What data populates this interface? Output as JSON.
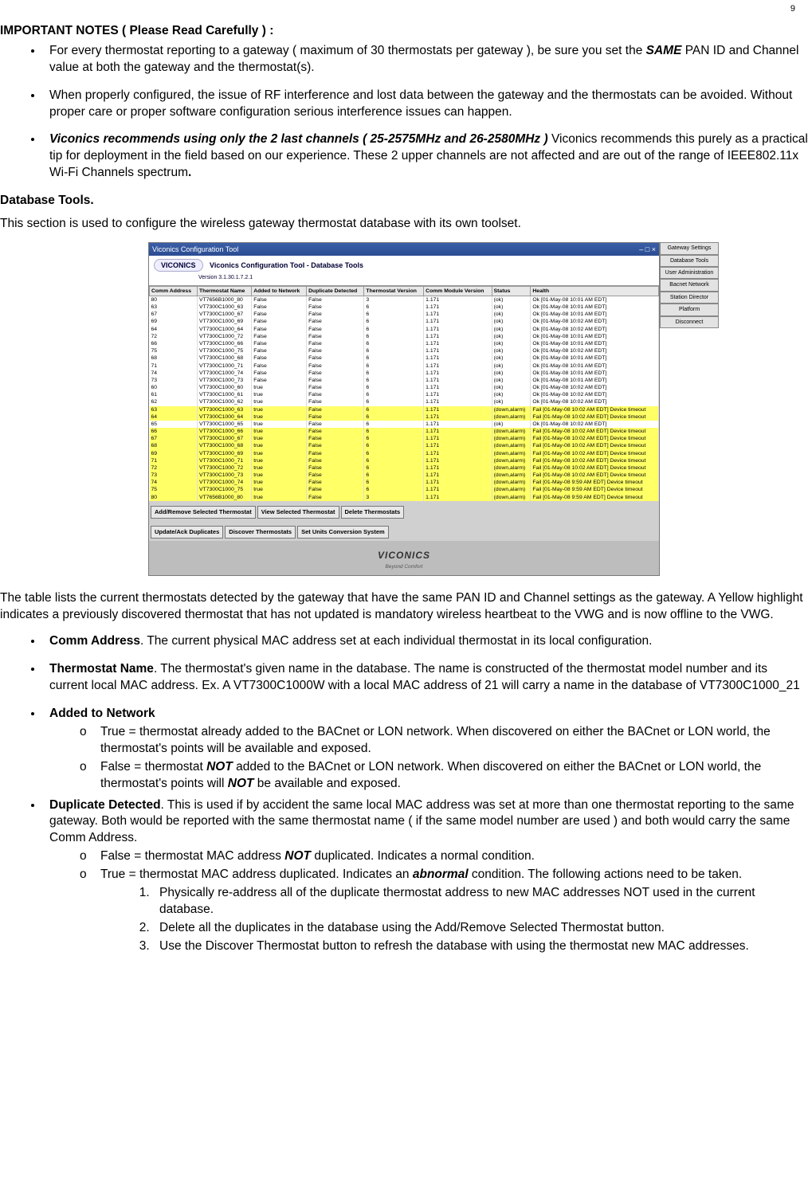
{
  "page_number": "9",
  "important_heading": "IMPORTANT NOTES ( Please Read Carefully ) :",
  "important": [
    {
      "pre": "For every thermostat reporting to a gateway ( maximum of 30 thermostats per gateway ), be sure you set the ",
      "bi": "SAME",
      "post": " PAN ID and Channel value at both the gateway and the thermostat(s)."
    },
    {
      "text": "When properly configured, the issue of RF interference and lost data between the gateway and the thermostats can be avoided. Without proper care or proper software configuration serious interference issues can happen."
    },
    {
      "bi": "Viconics recommends using only the 2 last channels ( 25-2575MHz and 26-2580MHz )",
      "post": " Viconics recommends this purely as a practical tip for deployment in the field based on our experience. These 2 upper channels are not affected and are out of the range of IEEE802.11x Wi-Fi Channels spectrum",
      "dot": "."
    }
  ],
  "db_heading": "Database Tools.",
  "db_intro": "This section is used to configure the wireless gateway thermostat database with its own toolset.",
  "screenshot": {
    "titlebar": "Viconics Configuration Tool",
    "brand": "VICONICS",
    "header_title": "Viconics Configuration Tool - Database Tools",
    "header_version": "Version 3.1.30.1.7.2.1",
    "side_buttons": [
      "Gateway Settings",
      "Database Tools",
      "User Administration",
      "Bacnet Network",
      "Station Director",
      "Platform",
      "Disconnect"
    ],
    "columns": [
      "Comm Address",
      "Thermostat Name",
      "Added to Network",
      "Duplicate Detected",
      "Thermostat Version",
      "Comm Module Version",
      "Status",
      "Health"
    ],
    "rows": [
      {
        "addr": "80",
        "name": "VT7656B1000_80",
        "added": "False",
        "dup": "False",
        "tv": "3",
        "cmv": "1.171",
        "status": "(ok)",
        "health": "Ok [01-May-08 10:01 AM EDT]",
        "fail": false
      },
      {
        "addr": "63",
        "name": "VT7300C1000_63",
        "added": "False",
        "dup": "False",
        "tv": "6",
        "cmv": "1.171",
        "status": "(ok)",
        "health": "Ok [01-May-08 10:01 AM EDT]",
        "fail": false
      },
      {
        "addr": "67",
        "name": "VT7300C1000_67",
        "added": "False",
        "dup": "False",
        "tv": "6",
        "cmv": "1.171",
        "status": "(ok)",
        "health": "Ok [01-May-08 10:01 AM EDT]",
        "fail": false
      },
      {
        "addr": "69",
        "name": "VT7300C1000_69",
        "added": "False",
        "dup": "False",
        "tv": "6",
        "cmv": "1.171",
        "status": "(ok)",
        "health": "Ok [01-May-08 10:02 AM EDT]",
        "fail": false
      },
      {
        "addr": "64",
        "name": "VT7300C1000_64",
        "added": "False",
        "dup": "False",
        "tv": "6",
        "cmv": "1.171",
        "status": "(ok)",
        "health": "Ok [01-May-08 10:02 AM EDT]",
        "fail": false
      },
      {
        "addr": "72",
        "name": "VT7300C1000_72",
        "added": "False",
        "dup": "False",
        "tv": "6",
        "cmv": "1.171",
        "status": "(ok)",
        "health": "Ok [01-May-08 10:01 AM EDT]",
        "fail": false
      },
      {
        "addr": "66",
        "name": "VT7300C1000_66",
        "added": "False",
        "dup": "False",
        "tv": "6",
        "cmv": "1.171",
        "status": "(ok)",
        "health": "Ok [01-May-08 10:01 AM EDT]",
        "fail": false
      },
      {
        "addr": "75",
        "name": "VT7300C1000_75",
        "added": "False",
        "dup": "False",
        "tv": "6",
        "cmv": "1.171",
        "status": "(ok)",
        "health": "Ok [01-May-08 10:02 AM EDT]",
        "fail": false
      },
      {
        "addr": "68",
        "name": "VT7300C1000_68",
        "added": "False",
        "dup": "False",
        "tv": "6",
        "cmv": "1.171",
        "status": "(ok)",
        "health": "Ok [01-May-08 10:01 AM EDT]",
        "fail": false
      },
      {
        "addr": "71",
        "name": "VT7300C1000_71",
        "added": "False",
        "dup": "False",
        "tv": "6",
        "cmv": "1.171",
        "status": "(ok)",
        "health": "Ok [01-May-08 10:01 AM EDT]",
        "fail": false
      },
      {
        "addr": "74",
        "name": "VT7300C1000_74",
        "added": "False",
        "dup": "False",
        "tv": "6",
        "cmv": "1.171",
        "status": "(ok)",
        "health": "Ok [01-May-08 10:01 AM EDT]",
        "fail": false
      },
      {
        "addr": "73",
        "name": "VT7300C1000_73",
        "added": "False",
        "dup": "False",
        "tv": "6",
        "cmv": "1.171",
        "status": "(ok)",
        "health": "Ok [01-May-08 10:01 AM EDT]",
        "fail": false
      },
      {
        "addr": "60",
        "name": "VT7300C1000_60",
        "added": "true",
        "dup": "False",
        "tv": "6",
        "cmv": "1.171",
        "status": "(ok)",
        "health": "Ok [01-May-08 10:02 AM EDT]",
        "fail": false
      },
      {
        "addr": "61",
        "name": "VT7300C1000_61",
        "added": "true",
        "dup": "False",
        "tv": "6",
        "cmv": "1.171",
        "status": "(ok)",
        "health": "Ok [01-May-08 10:02 AM EDT]",
        "fail": false
      },
      {
        "addr": "62",
        "name": "VT7300C1000_62",
        "added": "true",
        "dup": "False",
        "tv": "6",
        "cmv": "1.171",
        "status": "(ok)",
        "health": "Ok [01-May-08 10:02 AM EDT]",
        "fail": false
      },
      {
        "addr": "63",
        "name": "VT7300C1000_63",
        "added": "true",
        "dup": "False",
        "tv": "6",
        "cmv": "1.171",
        "status": "(down,alarm)",
        "health": "Fail [01-May-08 10:02 AM EDT] Device timeout",
        "fail": true
      },
      {
        "addr": "64",
        "name": "VT7300C1000_64",
        "added": "true",
        "dup": "False",
        "tv": "6",
        "cmv": "1.171",
        "status": "(down,alarm)",
        "health": "Fail [01-May-08 10:02 AM EDT] Device timeout",
        "fail": true
      },
      {
        "addr": "65",
        "name": "VT7300C1000_65",
        "added": "true",
        "dup": "False",
        "tv": "6",
        "cmv": "1.171",
        "status": "(ok)",
        "health": "Ok [01-May-08 10:02 AM EDT]",
        "fail": false
      },
      {
        "addr": "66",
        "name": "VT7300C1000_66",
        "added": "true",
        "dup": "False",
        "tv": "6",
        "cmv": "1.171",
        "status": "(down,alarm)",
        "health": "Fail [01-May-08 10:02 AM EDT] Device timeout",
        "fail": true
      },
      {
        "addr": "67",
        "name": "VT7300C1000_67",
        "added": "true",
        "dup": "False",
        "tv": "6",
        "cmv": "1.171",
        "status": "(down,alarm)",
        "health": "Fail [01-May-08 10:02 AM EDT] Device timeout",
        "fail": true
      },
      {
        "addr": "68",
        "name": "VT7300C1000_68",
        "added": "true",
        "dup": "False",
        "tv": "6",
        "cmv": "1.171",
        "status": "(down,alarm)",
        "health": "Fail [01-May-08 10:02 AM EDT] Device timeout",
        "fail": true
      },
      {
        "addr": "69",
        "name": "VT7300C1000_69",
        "added": "true",
        "dup": "False",
        "tv": "6",
        "cmv": "1.171",
        "status": "(down,alarm)",
        "health": "Fail [01-May-08 10:02 AM EDT] Device timeout",
        "fail": true
      },
      {
        "addr": "71",
        "name": "VT7300C1000_71",
        "added": "true",
        "dup": "False",
        "tv": "6",
        "cmv": "1.171",
        "status": "(down,alarm)",
        "health": "Fail [01-May-08 10:02 AM EDT] Device timeout",
        "fail": true
      },
      {
        "addr": "72",
        "name": "VT7300C1000_72",
        "added": "true",
        "dup": "False",
        "tv": "6",
        "cmv": "1.171",
        "status": "(down,alarm)",
        "health": "Fail [01-May-08 10:02 AM EDT] Device timeout",
        "fail": true
      },
      {
        "addr": "73",
        "name": "VT7300C1000_73",
        "added": "true",
        "dup": "False",
        "tv": "6",
        "cmv": "1.171",
        "status": "(down,alarm)",
        "health": "Fail [01-May-08 10:02 AM EDT] Device timeout",
        "fail": true
      },
      {
        "addr": "74",
        "name": "VT7300C1000_74",
        "added": "true",
        "dup": "False",
        "tv": "6",
        "cmv": "1.171",
        "status": "(down,alarm)",
        "health": "Fail [01-May-08 9:59 AM EDT] Device timeout",
        "fail": true
      },
      {
        "addr": "75",
        "name": "VT7300C1000_75",
        "added": "true",
        "dup": "False",
        "tv": "6",
        "cmv": "1.171",
        "status": "(down,alarm)",
        "health": "Fail [01-May-08 9:59 AM EDT] Device timeout",
        "fail": true
      },
      {
        "addr": "80",
        "name": "VT7656B1000_80",
        "added": "true",
        "dup": "False",
        "tv": "3",
        "cmv": "1.171",
        "status": "(down,alarm)",
        "health": "Fail [01-May-08 9:59 AM EDT] Device timeout",
        "fail": true
      }
    ],
    "action_buttons_row1": [
      "Add/Remove Selected Thermostat",
      "View Selected Thermostat",
      "Delete Thermostats"
    ],
    "action_buttons_row2": [
      "Update/Ack Duplicates",
      "Discover Thermostats",
      "Set Units Conversion System"
    ],
    "logo": "VICONICS",
    "logo_sub": "Beyond Comfort"
  },
  "table_para": "The table lists the current thermostats detected by the gateway that have the same PAN ID and Channel settings as the gateway. A Yellow highlight indicates a previously discovered thermostat that has not updated is mandatory wireless heartbeat to the VWG and is now offline to the VWG.",
  "fields": {
    "comm_title": "Comm Address",
    "comm_text": ". The current physical MAC address set at each individual thermostat in its local configuration.",
    "tname_title": "Thermostat Name",
    "tname_text": ". The thermostat's given name in the database. The name is constructed of the thermostat model number and its current local MAC address. Ex. A VT7300C1000W with a local MAC address of 21 will carry a name in the database of VT7300C1000_21",
    "added_title": "Added to Network",
    "added_true": "True = thermostat already added to the BACnet or LON network. When discovered on either the BACnet or LON world, the thermostat's points will be available and exposed.",
    "added_false_pre": "False = thermostat ",
    "added_false_bi": "NOT",
    "added_false_mid": " added to the BACnet or LON network. When discovered on either the BACnet or LON world, the thermostat's points will ",
    "added_false_bi2": "NOT",
    "added_false_post": " be available and exposed.",
    "dup_title": "Duplicate Detected",
    "dup_text": ". This is used if by accident the same local MAC address was set at more than one thermostat reporting to the same gateway. Both would be reported with the same thermostat name ( if the same model number are used ) and both would carry the same Comm Address.",
    "dup_false_pre": "False = thermostat MAC address ",
    "dup_false_bi": "NOT",
    "dup_false_post": " duplicated. Indicates a normal condition.",
    "dup_true_pre": "True = thermostat MAC address duplicated. Indicates an ",
    "dup_true_bi": "abnormal",
    "dup_true_post": " condition. The following actions need to be taken.",
    "dup_actions": [
      "Physically re-address all of the duplicate thermostat address to new MAC addresses NOT used in the current database.",
      "Delete all the duplicates in the database using the Add/Remove Selected Thermostat button.",
      "Use the Discover Thermostat button to refresh the database with using the thermostat new MAC addresses."
    ]
  }
}
